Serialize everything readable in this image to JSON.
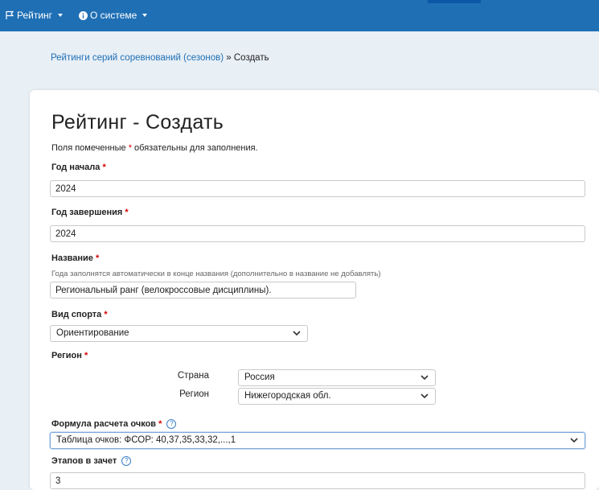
{
  "navbar": {
    "menu_rating": "Рейтинг",
    "menu_about": "О системе"
  },
  "breadcrumb": {
    "link": "Рейтинги серий соревнований (сезонов)",
    "separator": " » ",
    "current": "Создать"
  },
  "page": {
    "title": "Рейтинг - Создать",
    "required_note_before": "Поля помеченные ",
    "required_marker": "*",
    "required_note_after": " обязательны для заполнения."
  },
  "form": {
    "start_year": {
      "label": "Год начала",
      "value": "2024"
    },
    "end_year": {
      "label": "Год завершения",
      "value": "2024"
    },
    "name": {
      "label": "Название",
      "hint": "Года заполнятся автоматически в конце названия (дополнительно в название не добавлять)",
      "value": "Региональный ранг (велокроссовые дисциплины)."
    },
    "sport": {
      "label": "Вид спорта",
      "value": "Ориентирование"
    },
    "region": {
      "label": "Регион",
      "country_label": "Страна",
      "country_value": "Россия",
      "region_label": "Регион",
      "region_value": "Нижегородская обл."
    },
    "formula": {
      "label": "Формула расчета очков",
      "value": "Таблица очков: ФСОР: 40,37,35,33,32,...,1"
    },
    "stages": {
      "label": "Этапов в зачет",
      "value": "3"
    }
  },
  "colors": {
    "navbar": "#1f6fb5",
    "background": "#e8eff5",
    "required": "#d40000",
    "link": "#1f6fb5"
  }
}
